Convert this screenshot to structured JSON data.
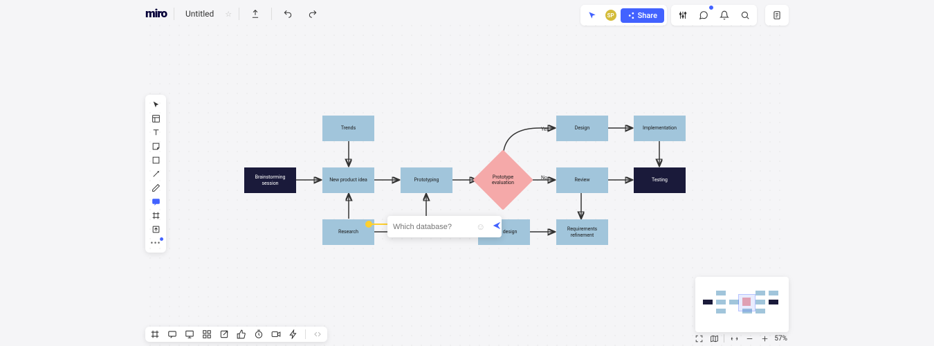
{
  "header": {
    "logo": "miro",
    "title": "Untitled",
    "share_label": "Share"
  },
  "flow": {
    "nodes": {
      "brainstorm": "Brainstorming session",
      "trends": "Trends",
      "new_idea": "New product idea",
      "research": "Research",
      "prototyping": "Prototyping",
      "evaluation": "Prototype evaluation",
      "review": "Review",
      "spec_design": "Spec design",
      "req_refine": "Requirements refinement",
      "design": "Design",
      "implementation": "Implementation",
      "testing": "Testing"
    },
    "edges": {
      "yes": "Yes",
      "no": "No"
    }
  },
  "comment": {
    "placeholder": "Which database?"
  },
  "zoom": {
    "level": "57%"
  }
}
